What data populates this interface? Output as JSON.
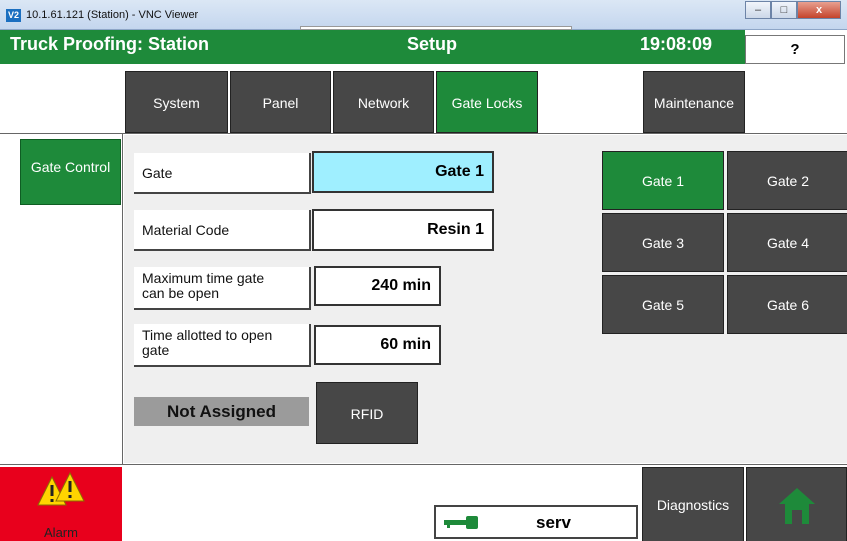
{
  "window": {
    "title": "10.1.61.121 (Station) - VNC Viewer",
    "icon": "V2",
    "min": "–",
    "max": "□",
    "close": "x"
  },
  "header": {
    "title": "Truck Proofing: Station",
    "screen": "Setup",
    "time": "19:08:09",
    "help": "?"
  },
  "tabs": [
    {
      "label": "System"
    },
    {
      "label": "Panel"
    },
    {
      "label": "Network"
    },
    {
      "label": "Gate Locks"
    },
    {
      "label": "Maintenance"
    }
  ],
  "nav": {
    "gate_control": "Gate Control"
  },
  "form": {
    "gate_label": "Gate",
    "gate_value": "Gate 1",
    "material_label": "Material Code",
    "material_value": "Resin 1",
    "max_time_label": "Maximum time gate can be open",
    "max_time_value": "240 min",
    "allotted_label": "Time allotted to open gate",
    "allotted_value": "60 min",
    "assign_status": "Not Assigned",
    "rfid": "RFID"
  },
  "gates": [
    {
      "label": "Gate 1"
    },
    {
      "label": "Gate 2"
    },
    {
      "label": "Gate 3"
    },
    {
      "label": "Gate 4"
    },
    {
      "label": "Gate 5"
    },
    {
      "label": "Gate 6"
    }
  ],
  "footer": {
    "alarm": "Alarm",
    "user": "serv",
    "diagnostics": "Diagnostics"
  },
  "colors": {
    "green": "#1e8a3a",
    "button": "#474747",
    "highlight": "#9fefff",
    "alarm": "#e8001c"
  }
}
